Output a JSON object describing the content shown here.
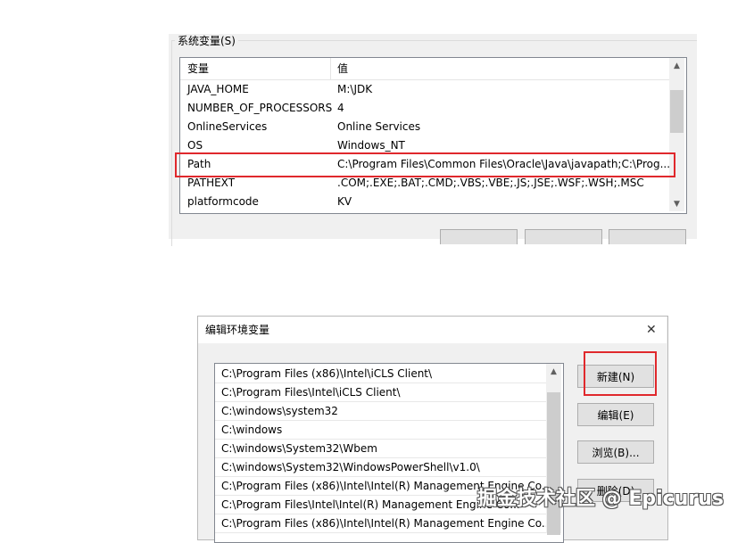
{
  "system_vars": {
    "group_title": "系统变量(S)",
    "columns": [
      "变量",
      "值"
    ],
    "rows": [
      {
        "name": "JAVA_HOME",
        "value": "M:\\JDK"
      },
      {
        "name": "NUMBER_OF_PROCESSORS",
        "value": "4"
      },
      {
        "name": "OnlineServices",
        "value": "Online Services"
      },
      {
        "name": "OS",
        "value": "Windows_NT"
      },
      {
        "name": "Path",
        "value": "C:\\Program Files\\Common Files\\Oracle\\Java\\javapath;C:\\Prog..."
      },
      {
        "name": "PATHEXT",
        "value": ".COM;.EXE;.BAT;.CMD;.VBS;.VBE;.JS;.JSE;.WSF;.WSH;.MSC"
      },
      {
        "name": "platformcode",
        "value": "KV"
      }
    ],
    "highlight_color": "#e0282c"
  },
  "edit_dialog": {
    "title": "编辑环境变量",
    "entries": [
      "C:\\Program Files (x86)\\Intel\\iCLS Client\\",
      "C:\\Program Files\\Intel\\iCLS Client\\",
      "C:\\windows\\system32",
      "C:\\windows",
      "C:\\windows\\System32\\Wbem",
      "C:\\windows\\System32\\WindowsPowerShell\\v1.0\\",
      "C:\\Program Files (x86)\\Intel\\Intel(R) Management Engine Co...",
      "C:\\Program Files\\Intel\\Intel(R) Management Engine Co...",
      "C:\\Program Files (x86)\\Intel\\Intel(R) Management Engine Co..."
    ],
    "buttons": {
      "new": "新建(N)",
      "edit": "编辑(E)",
      "browse": "浏览(B)...",
      "delete": "删除(D)"
    }
  },
  "watermark": "掘金技术社区 @ Epicurus"
}
